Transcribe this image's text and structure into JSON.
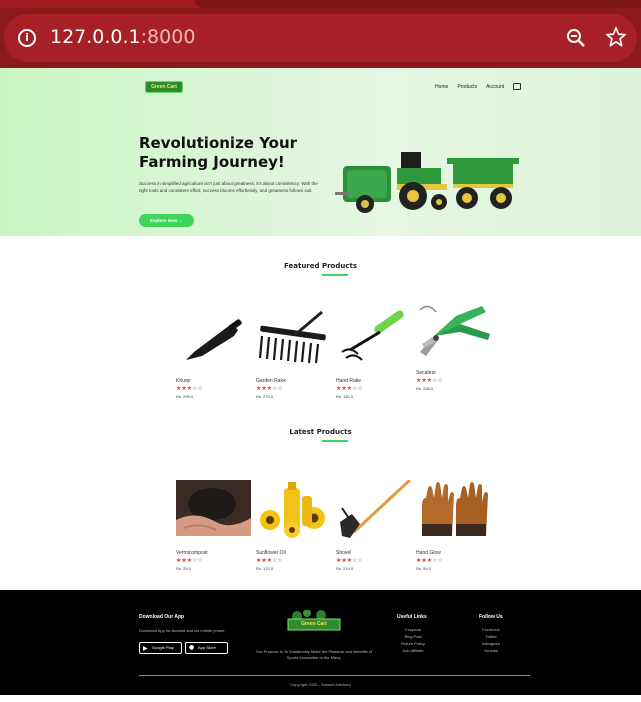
{
  "browser": {
    "url_host": "127.0.0.1",
    "url_port": ":8000"
  },
  "nav": {
    "logo_text": "Green Cart",
    "items": [
      "Home",
      "Products",
      "Account"
    ]
  },
  "hero": {
    "title_line1": "Revolutionize Your",
    "title_line2": "Farming Journey!",
    "description": "Success in simplified agriculture isn't just about greatness; it's about consistency. With the right tools and consistent effort, success blooms effortlessly, and greatness follows suit.",
    "cta_label": "Explore Now →"
  },
  "featured": {
    "title": "Featured Products",
    "products": [
      {
        "name": "Khurpi",
        "stars": "★★★☆☆",
        "price": "Rs. 299.0"
      },
      {
        "name": "Garden Rake",
        "stars": "★★★☆☆",
        "price": "Rs. 279.0"
      },
      {
        "name": "Hand Rake",
        "stars": "★★★☆☆",
        "price": "Rs. 150.0"
      },
      {
        "name": "Secateur",
        "stars": "★★★☆☆",
        "price": "Rs. 208.0"
      }
    ]
  },
  "latest": {
    "title": "Latest Products",
    "products": [
      {
        "name": "Vermicompost",
        "stars": "★★★☆☆",
        "price": "Rs. 29.0"
      },
      {
        "name": "Sunflower Oil",
        "stars": "★★★☆☆",
        "price": "Rs. 123.0"
      },
      {
        "name": "Shovel",
        "stars": "★★★☆☆",
        "price": "Rs. 219.0"
      },
      {
        "name": "Hand Glow",
        "stars": "★★★☆☆",
        "price": "Rs. 99.0"
      }
    ]
  },
  "footer": {
    "download_title": "Download Our App",
    "download_text": "Download App for Android and ios mobile phone.",
    "google_play": "Google Play",
    "app_store": "App Store",
    "logo_text": "Green Cart",
    "purpose": "Our Purpose Is To Sustainably Make the Pleasure and Benefits of Sports Accessible to the Many.",
    "useful_title": "Useful Links",
    "useful_links": [
      "Coupons",
      "Blog Post",
      "Return Policy",
      "Join Affiliate"
    ],
    "follow_title": "Follow Us",
    "follow_links": [
      "Facebook",
      "Twitter",
      "Instagram",
      "Youtube"
    ],
    "copyright": "Copyright 2020 - Samuel Adhikary"
  }
}
